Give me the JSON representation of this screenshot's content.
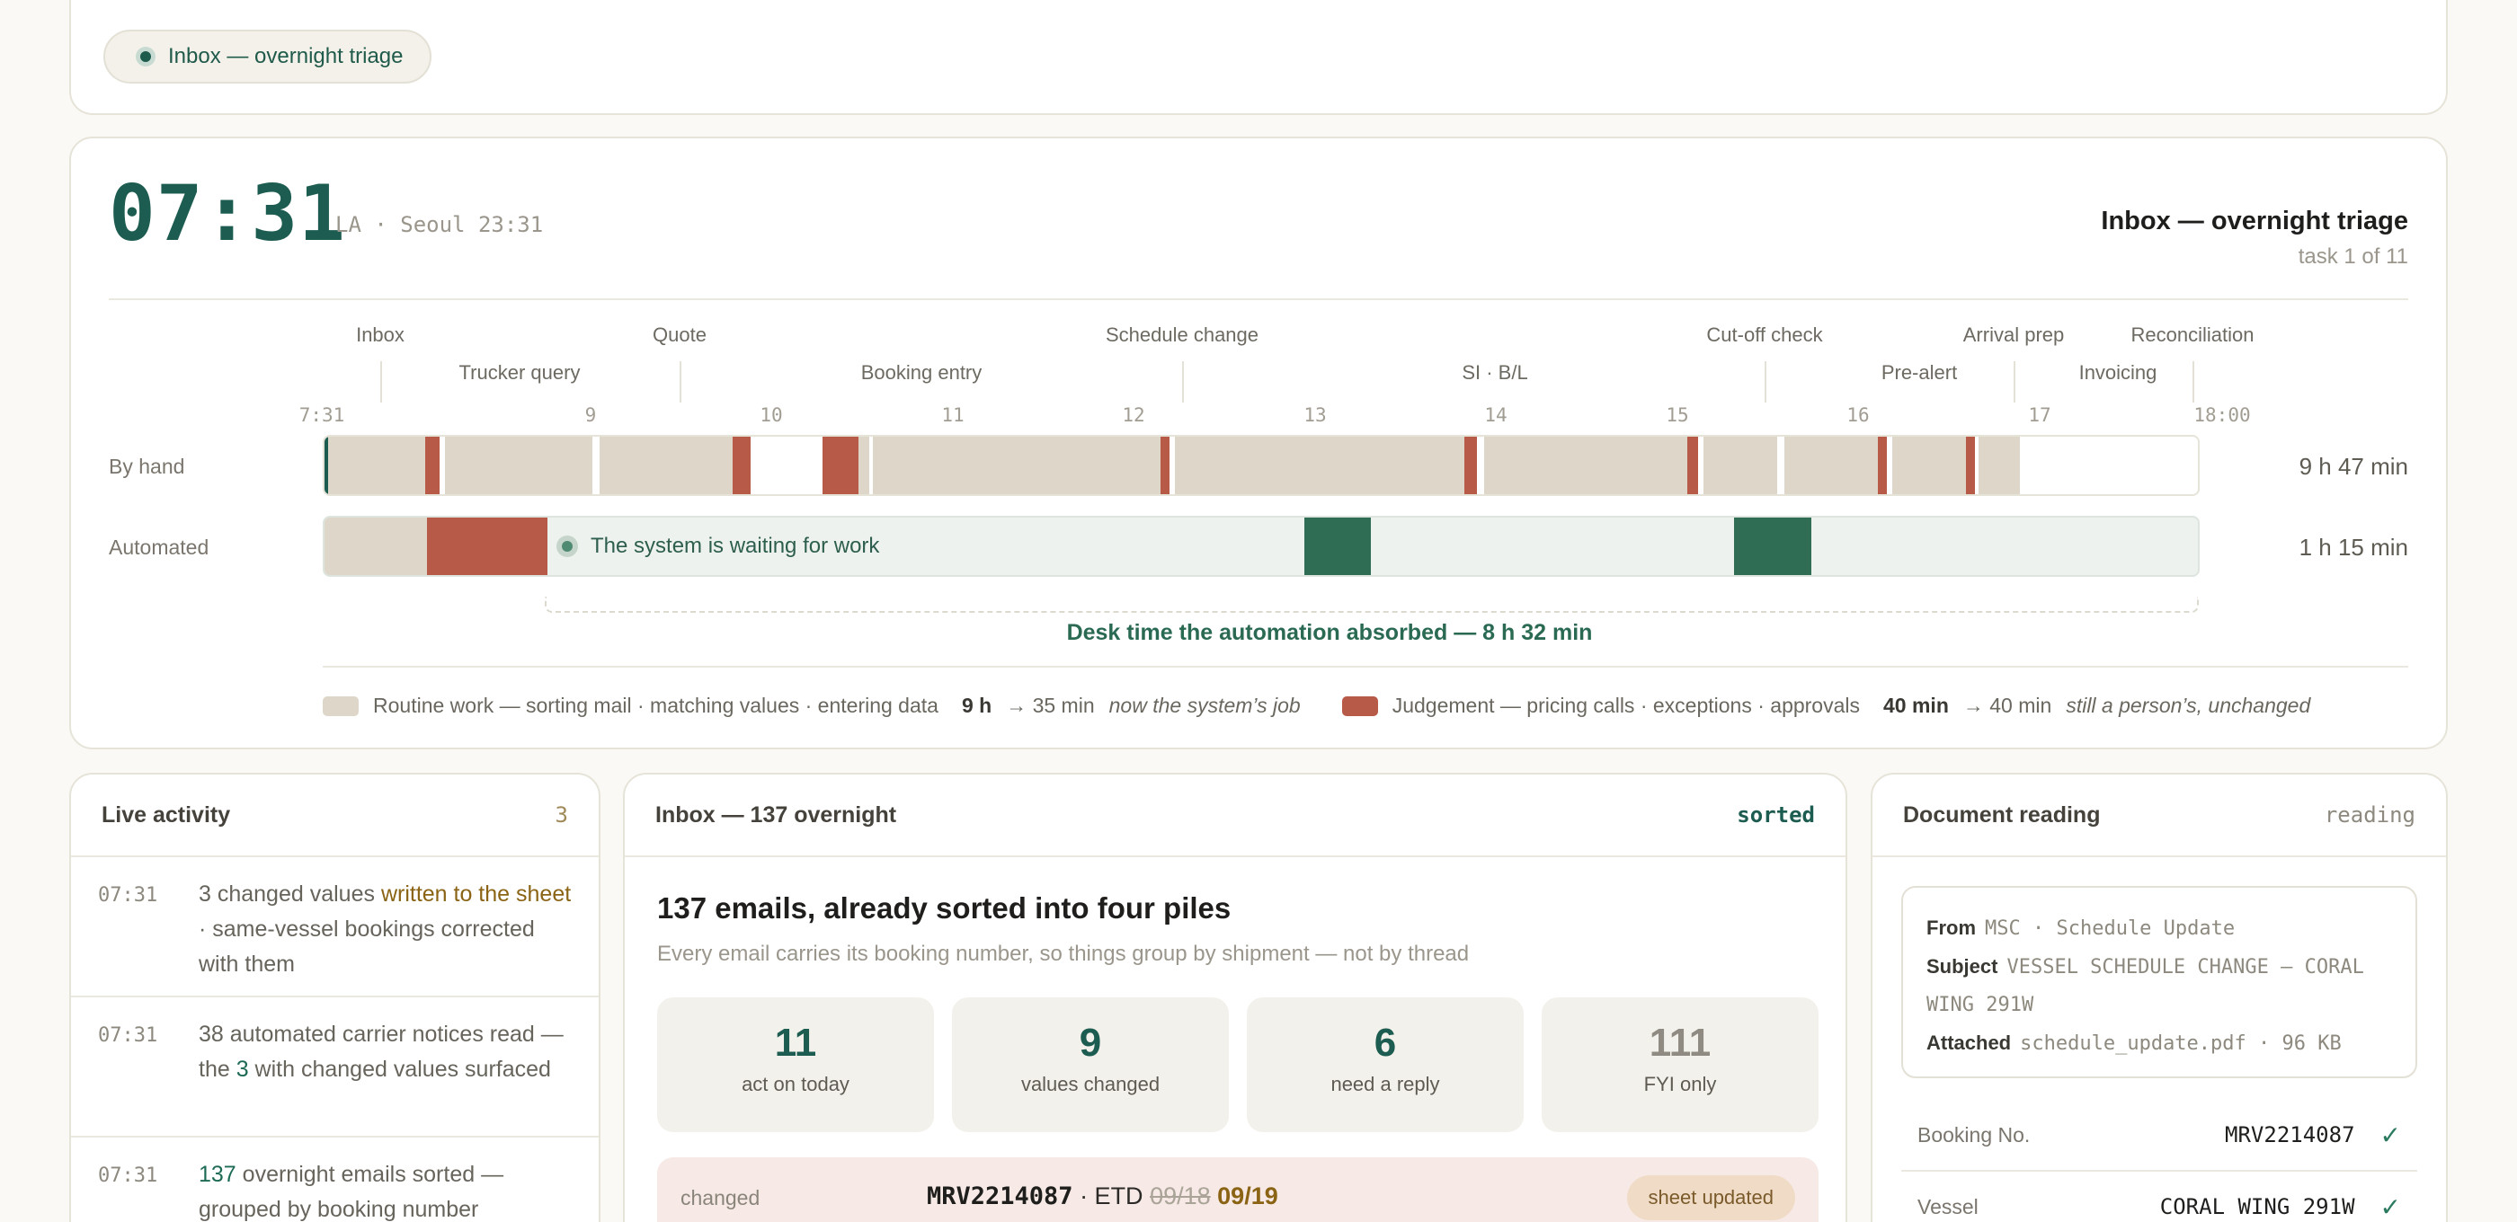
{
  "topbar": {
    "chip_label": "Inbox — overnight triage"
  },
  "header": {
    "clock": "07:31",
    "clock_sub": "LA · Seoul 23:31",
    "task_title": "Inbox — overnight triage",
    "task_progress": "task 1 of 11"
  },
  "phases_top": [
    "Inbox",
    "Quote",
    "Schedule change",
    "Cut-off check",
    "Arrival prep",
    "Reconciliation"
  ],
  "phases_bottom": [
    "Trucker query",
    "Booking entry",
    "SI · B/L",
    "Pre-alert",
    "Invoicing"
  ],
  "hours": [
    "7:31",
    "9",
    "10",
    "11",
    "12",
    "13",
    "14",
    "15",
    "16",
    "17",
    "18:00"
  ],
  "rows": {
    "hand_label": "By hand",
    "hand_total": "9 h 47 min",
    "auto_label": "Automated",
    "auto_total": "1 h 15 min",
    "waiting_label": "The system is waiting for work"
  },
  "absorbed": "Desk time the automation absorbed — 8 h 32 min",
  "legend": {
    "routine_label": "Routine work — sorting mail · matching values · entering data",
    "routine_before": "9 h",
    "routine_after": "→ 35 min",
    "routine_note": "now the system’s job",
    "judgement_label": "Judgement — pricing calls · exceptions · approvals",
    "judgement_before": "40 min",
    "judgement_after": "→ 40 min",
    "judgement_note": "still a person’s, unchanged"
  },
  "colors": {
    "routine": "#ded6c9",
    "judgement": "#b75a48",
    "automated": "#2f6e55",
    "accent": "#1d5c50"
  },
  "live": {
    "title": "Live activity",
    "count": "3",
    "items": [
      {
        "time": "07:31",
        "a": "3 changed values ",
        "b": "written to the sheet",
        "c": " · same-vessel bookings corrected with them"
      },
      {
        "time": "07:31",
        "a": "38 automated carrier notices read — the ",
        "b": "3",
        "c": " with changed values surfaced"
      },
      {
        "time": "07:31",
        "a": "",
        "b": "137",
        "c": " overnight emails sorted — grouped by booking number"
      }
    ]
  },
  "inbox": {
    "title": "Inbox — 137 overnight",
    "status": "sorted",
    "heading": "137 emails, already sorted into four piles",
    "subheading": "Every email carries its booking number, so things group by shipment — not by thread",
    "stats": [
      {
        "num": "11",
        "label": "act on today"
      },
      {
        "num": "9",
        "label": "values changed"
      },
      {
        "num": "6",
        "label": "need a reply"
      },
      {
        "num": "111",
        "label": "FYI only"
      }
    ],
    "changed": {
      "label": "changed",
      "booking": "MRV2214087",
      "field": " · ETD ",
      "old": "09/18",
      "new": "09/19",
      "pill": "sheet updated"
    }
  },
  "docread": {
    "title": "Document reading",
    "status": "reading",
    "from_k": "From",
    "from_v": "MSC · Schedule Update",
    "subject_k": "Subject",
    "subject_v": "VESSEL SCHEDULE CHANGE — CORAL WING 291W",
    "attached_k": "Attached",
    "attached_v": "schedule_update.pdf · 96 KB",
    "fields": [
      {
        "k": "Booking No.",
        "v": "MRV2214087",
        "check": "✓"
      },
      {
        "k": "Vessel",
        "v": "CORAL WING 291W",
        "check": "✓"
      }
    ]
  }
}
